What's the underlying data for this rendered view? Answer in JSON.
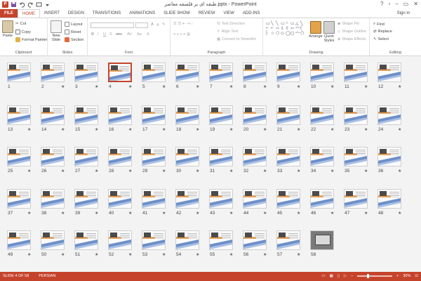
{
  "app": {
    "title": "طبقه ای بر فلسفه معاصر.pptx - PowerPoint",
    "help": "?",
    "minimize": "–",
    "restore": "▭",
    "close": "✕",
    "sign_in": "Sign in"
  },
  "tabs": [
    "FILE",
    "HOME",
    "INSERT",
    "DESIGN",
    "TRANSITIONS",
    "ANIMATIONS",
    "SLIDE SHOW",
    "REVIEW",
    "VIEW",
    "ADD-INS"
  ],
  "active_tab": "HOME",
  "ribbon": {
    "clipboard": {
      "label": "Clipboard",
      "paste": "Paste",
      "cut": "Cut",
      "copy": "Copy",
      "format_painter": "Format Painter"
    },
    "slides": {
      "label": "Slides",
      "new_slide": "New Slide",
      "layout": "Layout",
      "reset": "Reset",
      "section": "Section"
    },
    "font": {
      "label": "Font"
    },
    "paragraph": {
      "label": "Paragraph",
      "text_direction": "Text Direction",
      "align_text": "Align Text",
      "convert_smartart": "Convert to SmartArt"
    },
    "drawing": {
      "label": "Drawing",
      "arrange": "Arrange",
      "quick_styles": "Quick Styles",
      "shape_fill": "Shape Fill",
      "shape_outline": "Shape Outline",
      "shape_effects": "Shape Effects"
    },
    "editing": {
      "label": "Editing",
      "find": "Find",
      "replace": "Replace",
      "select": "Select"
    }
  },
  "slides": [
    {
      "n": "1",
      "star": false
    },
    {
      "n": "2",
      "star": true
    },
    {
      "n": "3",
      "star": true
    },
    {
      "n": "4",
      "star": true,
      "selected": true
    },
    {
      "n": "5",
      "star": true
    },
    {
      "n": "6",
      "star": true
    },
    {
      "n": "7",
      "star": true
    },
    {
      "n": "8",
      "star": true
    },
    {
      "n": "9",
      "star": true
    },
    {
      "n": "10",
      "star": true
    },
    {
      "n": "11",
      "star": true
    },
    {
      "n": "12",
      "star": true
    },
    {
      "n": "13",
      "star": true
    },
    {
      "n": "14",
      "star": true
    },
    {
      "n": "15",
      "star": true
    },
    {
      "n": "16",
      "star": true
    },
    {
      "n": "17",
      "star": true
    },
    {
      "n": "18",
      "star": true
    },
    {
      "n": "19",
      "star": true
    },
    {
      "n": "20",
      "star": true
    },
    {
      "n": "21",
      "star": true
    },
    {
      "n": "22",
      "star": true
    },
    {
      "n": "23",
      "star": true
    },
    {
      "n": "24",
      "star": true
    },
    {
      "n": "25",
      "star": true
    },
    {
      "n": "26",
      "star": true
    },
    {
      "n": "27",
      "star": true
    },
    {
      "n": "28",
      "star": true
    },
    {
      "n": "29",
      "star": true
    },
    {
      "n": "30",
      "star": true
    },
    {
      "n": "31",
      "star": true
    },
    {
      "n": "32",
      "star": true
    },
    {
      "n": "33",
      "star": true
    },
    {
      "n": "34",
      "star": true
    },
    {
      "n": "35",
      "star": true
    },
    {
      "n": "36",
      "star": true
    },
    {
      "n": "37",
      "star": true
    },
    {
      "n": "38",
      "star": true
    },
    {
      "n": "39",
      "star": true
    },
    {
      "n": "40",
      "star": true
    },
    {
      "n": "41",
      "star": true
    },
    {
      "n": "42",
      "star": true
    },
    {
      "n": "43",
      "star": true
    },
    {
      "n": "44",
      "star": true
    },
    {
      "n": "45",
      "star": true
    },
    {
      "n": "46",
      "star": true
    },
    {
      "n": "47",
      "star": true
    },
    {
      "n": "48",
      "star": true
    },
    {
      "n": "49",
      "star": true
    },
    {
      "n": "50",
      "star": true
    },
    {
      "n": "51",
      "star": true
    },
    {
      "n": "52",
      "star": true
    },
    {
      "n": "53",
      "star": true
    },
    {
      "n": "54",
      "star": true
    },
    {
      "n": "55",
      "star": true
    },
    {
      "n": "56",
      "star": true
    },
    {
      "n": "57",
      "star": true
    },
    {
      "n": "58",
      "star": false,
      "photo": true
    }
  ],
  "status": {
    "slide": "SLIDE 4 OF 58",
    "language": "PERSIAN",
    "zoom": "30%",
    "zoom_minus": "–",
    "zoom_plus": "+"
  },
  "colors": {
    "accent": "#c5432b",
    "sorter_bg": "#f3f3f3"
  }
}
